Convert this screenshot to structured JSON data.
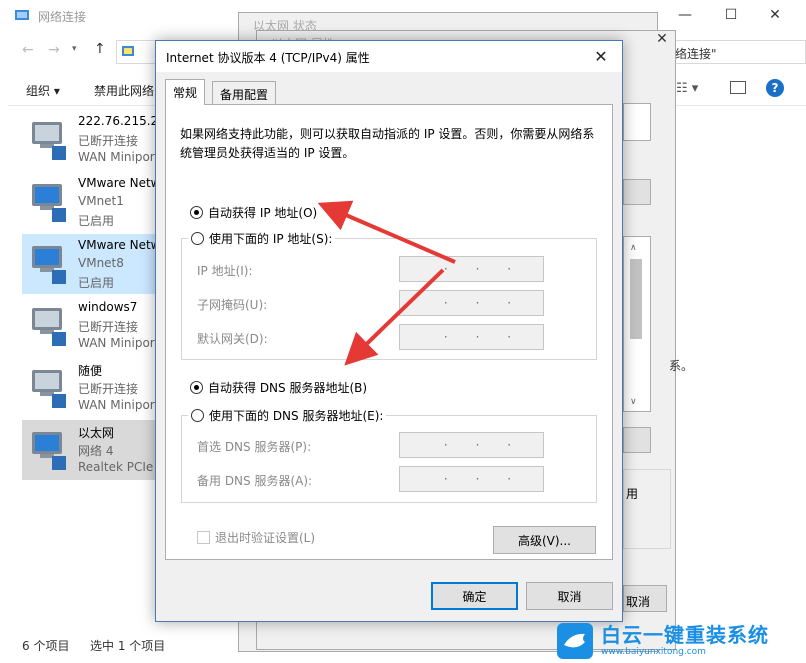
{
  "explorer": {
    "title": "网络连接",
    "breadcrumb_tail": "络连接\"",
    "toolbar": {
      "organize": "组织 ▾",
      "disable": "禁用此网络"
    },
    "items": [
      {
        "name": "222.76.215.21",
        "status": "已断开连接",
        "device": "WAN Miniport"
      },
      {
        "name": "VMware Netw",
        "status": "VMnet1",
        "device": "已启用"
      },
      {
        "name": "VMware Netw",
        "status": "VMnet8",
        "device": "已启用"
      },
      {
        "name": "windows7",
        "status": "已断开连接",
        "device": "WAN Miniport"
      },
      {
        "name": "随便",
        "status": "已断开连接",
        "device": "WAN Miniport"
      },
      {
        "name": "以太网",
        "status": "网络 4",
        "device": "Realtek PCIe"
      }
    ],
    "status": {
      "count": "6 个项目",
      "selected": "选中 1 个项目"
    }
  },
  "bg_window": {
    "title": "以太网 状态",
    "title2": "以太网 属性",
    "cancel_label": "取消",
    "use_label": "用",
    "partial_char": "系。"
  },
  "dialog": {
    "title": "Internet 协议版本 4 (TCP/IPv4) 属性",
    "tabs": [
      "常规",
      "备用配置"
    ],
    "description": "如果网络支持此功能，则可以获取自动指派的 IP 设置。否则，你需要从网络系统管理员处获得适当的 IP 设置。",
    "ip_auto": "自动获得 IP 地址(O)",
    "ip_manual": "使用下面的 IP 地址(S):",
    "ip_fields": [
      "IP 地址(I):",
      "子网掩码(U):",
      "默认网关(D):"
    ],
    "dns_auto": "自动获得 DNS 服务器地址(B)",
    "dns_manual": "使用下面的 DNS 服务器地址(E):",
    "dns_fields": [
      "首选 DNS 服务器(P):",
      "备用 DNS 服务器(A):"
    ],
    "validate": "退出时验证设置(L)",
    "advanced": "高级(V)...",
    "ok": "确定",
    "cancel": "取消",
    "dots": "·",
    "ip_auto_selected": true,
    "dns_auto_selected": true
  },
  "watermark": {
    "brand": "白云一键重装系统",
    "url": "www.baiyunxitong.com"
  },
  "colors": {
    "arrow": "#e53935",
    "accent": "#0078d7",
    "selected_row": "#cce8ff",
    "watermark": "#1a8fe3"
  }
}
